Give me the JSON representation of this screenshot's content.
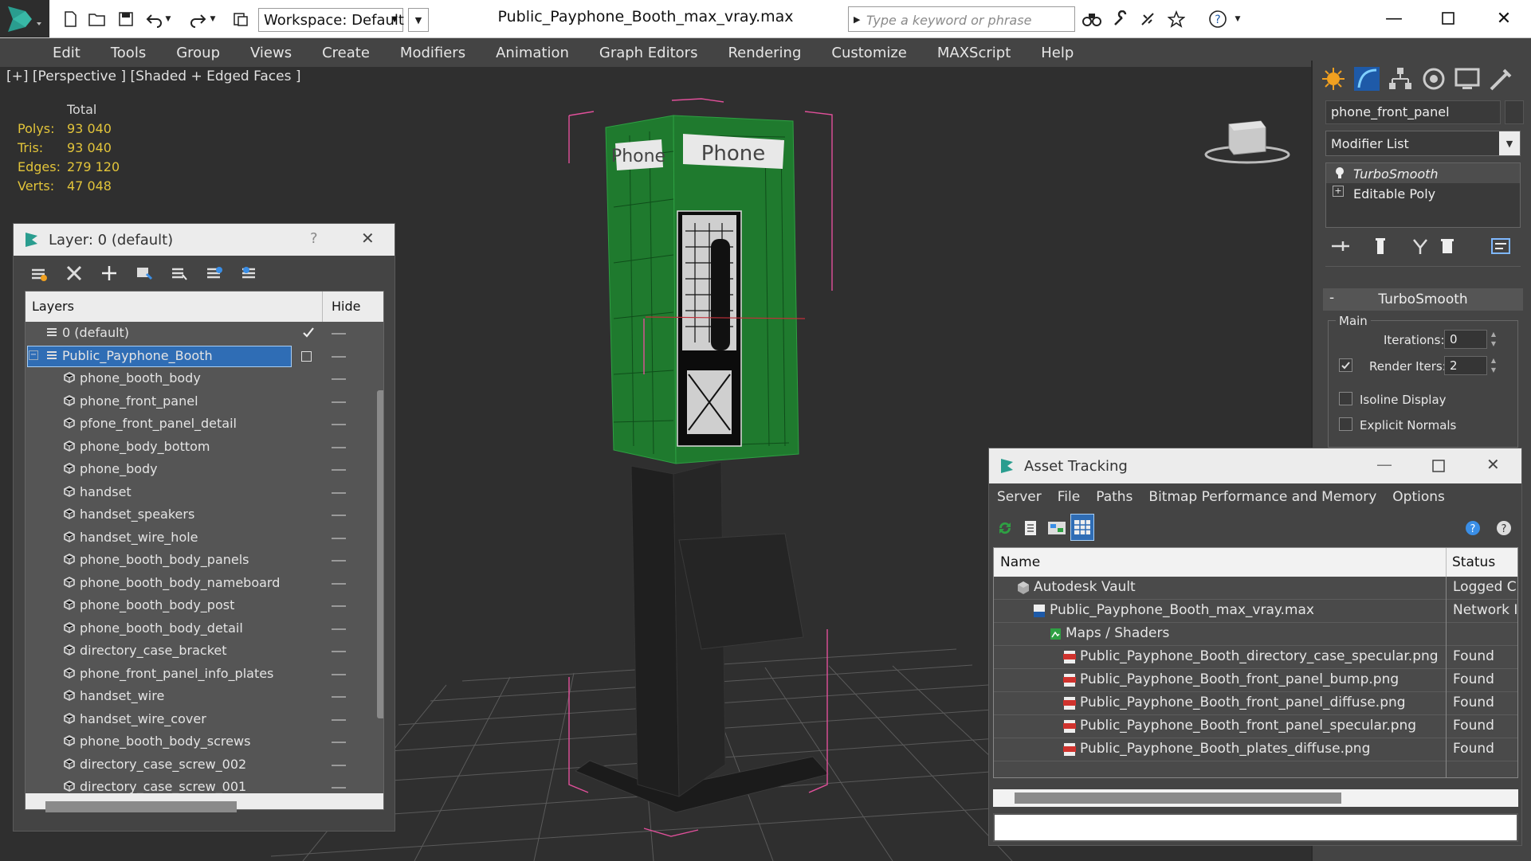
{
  "window": {
    "title": "Public_Payphone_Booth_max_vray.max",
    "workspace": "Workspace: Default",
    "search_placeholder": "Type a keyword or phrase"
  },
  "menu": [
    "Edit",
    "Tools",
    "Group",
    "Views",
    "Create",
    "Modifiers",
    "Animation",
    "Graph Editors",
    "Rendering",
    "Customize",
    "MAXScript",
    "Help"
  ],
  "viewport": {
    "label": "[+] [Perspective ] [Shaded + Edged Faces ]",
    "stats": {
      "header": "Total",
      "rows": [
        {
          "key": "Polys:",
          "value": "93 040"
        },
        {
          "key": "Tris:",
          "value": "93 040"
        },
        {
          "key": "Edges:",
          "value": "279 120"
        },
        {
          "key": "Verts:",
          "value": "47 048"
        }
      ]
    },
    "model_signs": [
      "Phone",
      "Phone"
    ]
  },
  "layer_panel": {
    "title": "Layer: 0 (default)",
    "help": "?",
    "columns": {
      "name": "Layers",
      "hide": "Hide"
    },
    "rows": [
      {
        "label": "0 (default)",
        "level": 0,
        "type": "layer",
        "checked": true
      },
      {
        "label": "Public_Payphone_Booth",
        "level": 0,
        "type": "layer",
        "selected": true
      },
      {
        "label": "phone_booth_body",
        "level": 1,
        "type": "object"
      },
      {
        "label": "phone_front_panel",
        "level": 1,
        "type": "object"
      },
      {
        "label": "pfone_front_panel_detail",
        "level": 1,
        "type": "object"
      },
      {
        "label": "phone_body_bottom",
        "level": 1,
        "type": "object"
      },
      {
        "label": "phone_body",
        "level": 1,
        "type": "object"
      },
      {
        "label": "handset",
        "level": 1,
        "type": "object"
      },
      {
        "label": "handset_speakers",
        "level": 1,
        "type": "object"
      },
      {
        "label": "handset_wire_hole",
        "level": 1,
        "type": "object"
      },
      {
        "label": "phone_booth_body_panels",
        "level": 1,
        "type": "object"
      },
      {
        "label": "phone_booth_body_nameboard",
        "level": 1,
        "type": "object"
      },
      {
        "label": "phone_booth_body_post",
        "level": 1,
        "type": "object"
      },
      {
        "label": "phone_booth_body_detail",
        "level": 1,
        "type": "object"
      },
      {
        "label": "directory_case_bracket",
        "level": 1,
        "type": "object"
      },
      {
        "label": "phone_front_panel_info_plates",
        "level": 1,
        "type": "object"
      },
      {
        "label": "handset_wire",
        "level": 1,
        "type": "object"
      },
      {
        "label": "handset_wire_cover",
        "level": 1,
        "type": "object"
      },
      {
        "label": "phone_booth_body_screws",
        "level": 1,
        "type": "object"
      },
      {
        "label": "directory_case_screw_002",
        "level": 1,
        "type": "object"
      },
      {
        "label": "directory_case_screw_001",
        "level": 1,
        "type": "object"
      }
    ]
  },
  "command_panel": {
    "object_name": "phone_front_panel",
    "modifier_list": "Modifier List",
    "stack": [
      "TurboSmooth",
      "Editable Poly"
    ],
    "rollout": {
      "title": "TurboSmooth",
      "collapse": "-",
      "group": "Main",
      "iterations_label": "Iterations:",
      "iterations_value": "0",
      "render_iters_label": "Render Iters:",
      "render_iters_value": "2",
      "render_iters_checked": true,
      "isoline_label": "Isoline Display",
      "isoline_checked": false,
      "explicit_label": "Explicit Normals",
      "explicit_checked": false
    }
  },
  "asset_tracking": {
    "title": "Asset Tracking",
    "menu": [
      "Server",
      "File",
      "Paths",
      "Bitmap Performance and Memory",
      "Options"
    ],
    "columns": {
      "name": "Name",
      "status": "Status"
    },
    "rows": [
      {
        "name": "Autodesk Vault",
        "status": "Logged C",
        "level": 0,
        "icon": "vault-icon"
      },
      {
        "name": "Public_Payphone_Booth_max_vray.max",
        "status": "Network I",
        "level": 1,
        "icon": "max-file-icon"
      },
      {
        "name": "Maps / Shaders",
        "status": "",
        "level": 2,
        "icon": "maps-icon"
      },
      {
        "name": "Public_Payphone_Booth_directory_case_specular.png",
        "status": "Found",
        "level": 3,
        "icon": "png-icon"
      },
      {
        "name": "Public_Payphone_Booth_front_panel_bump.png",
        "status": "Found",
        "level": 3,
        "icon": "png-icon"
      },
      {
        "name": "Public_Payphone_Booth_front_panel_diffuse.png",
        "status": "Found",
        "level": 3,
        "icon": "png-icon"
      },
      {
        "name": "Public_Payphone_Booth_front_panel_specular.png",
        "status": "Found",
        "level": 3,
        "icon": "png-icon"
      },
      {
        "name": "Public_Payphone_Booth_plates_diffuse.png",
        "status": "Found",
        "level": 3,
        "icon": "png-icon"
      }
    ],
    "path_value": ""
  },
  "colors": {
    "accent_selection": "#2f6db5",
    "stats_text": "#e2c43a",
    "booth_green": "#1f7a2e",
    "bounding_box": "#e0509a"
  }
}
